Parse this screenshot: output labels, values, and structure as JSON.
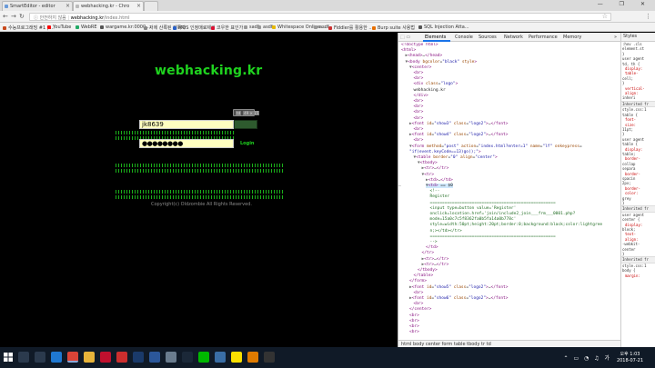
{
  "tabs": [
    {
      "label": "SmartEditor - editor",
      "active": false
    },
    {
      "label": "webhacking.kr - Chro",
      "active": true
    },
    {
      "label": "",
      "active": false
    }
  ],
  "window_buttons": "— ❐ ✕",
  "address": {
    "secure_label": "ⓘ 안전하지 않음",
    "host": "webhacking.kr",
    "path": "/index.html"
  },
  "bookmarks": [
    {
      "label": "수능프로그래밍 #1 | ...",
      "color": "#c84a1c"
    },
    {
      "label": "YouTube",
      "color": "#ff0000"
    },
    {
      "label": "WebRE",
      "color": "#2a6"
    },
    {
      "label": "wargame.kr:0000 ...",
      "color": "#555"
    },
    {
      "label": "저에 산록된 제목자",
      "color": "#888"
    },
    {
      "label": "MOS 인정매료제기",
      "color": "#2a62c9"
    },
    {
      "label": "코우한 표인가",
      "color": "#d13"
    },
    {
      "label": "sadf",
      "color": "#999"
    },
    {
      "label": "asdf",
      "color": "#999"
    },
    {
      "label": "Whitespace Online ...",
      "color": "#e6b800"
    },
    {
      "label": "asdf",
      "color": "#999"
    },
    {
      "label": "Fiddler를 활용한 ...",
      "color": "#c33"
    },
    {
      "label": "Burp suite 사용법",
      "color": "#e76f00"
    },
    {
      "label": "SQL Injection Atta...",
      "color": "#555"
    }
  ],
  "page": {
    "logo": "webhacking.kr",
    "id_value": "jk8639",
    "password_value": "●●●●●●●●",
    "login_label": "Login",
    "tooltip_tag": "td",
    "tooltip_size": "49 × 15",
    "copyright": "Copyright(c) Oldzombie All Rights Reserved."
  },
  "devtools": {
    "tabs": [
      "Elements",
      "Console",
      "Sources",
      "Network",
      "Performance",
      "Memory",
      "»"
    ],
    "lines": [
      {
        "indent": 0,
        "html": "<span class='tg'>&lt;!doctype html&gt;</span>"
      },
      {
        "indent": 0,
        "html": "<span class='tg'>&lt;html&gt;</span>"
      },
      {
        "indent": 1,
        "html": "<span class='arrow'>▶</span><span class='tg'>&lt;head&gt;</span>…<span class='tg'>&lt;/head&gt;</span>"
      },
      {
        "indent": 1,
        "html": "<span class='arrow'>▼</span><span class='tg'>&lt;body </span><span class='at'>bgcolor</span>=<span class='av'>\"black\"</span><span class='at'> style</span><span class='tg'>&gt;</span>"
      },
      {
        "indent": 2,
        "html": "<span class='arrow'>▼</span><span class='tg'>&lt;center&gt;</span>"
      },
      {
        "indent": 3,
        "html": "<span class='tg'>&lt;br&gt;</span>"
      },
      {
        "indent": 3,
        "html": "<span class='tg'>&lt;br&gt;</span>"
      },
      {
        "indent": 3,
        "html": "<span class='tg'>&lt;div </span><span class='at'>class</span>=<span class='av'>\"logo\"</span><span class='tg'>&gt;</span>"
      },
      {
        "indent": 3,
        "html": "<span class='tx'>webhacking.kr</span>"
      },
      {
        "indent": 3,
        "html": "<span class='tg'>&lt;/div&gt;</span>"
      },
      {
        "indent": 3,
        "html": "<span class='tg'>&lt;br&gt;</span>"
      },
      {
        "indent": 3,
        "html": "<span class='tg'>&lt;br&gt;</span>"
      },
      {
        "indent": 3,
        "html": "<span class='tg'>&lt;br&gt;</span>"
      },
      {
        "indent": 3,
        "html": "<span class='tg'>&lt;br&gt;</span>"
      },
      {
        "indent": 2,
        "html": "<span class='arrow'>▶</span><span class='tg'>&lt;font </span><span class='at'>id</span>=<span class='av'>\"show3\"</span><span class='at'> class</span>=<span class='av'>\"logo2\"</span><span class='tg'>&gt;</span>…<span class='tg'>&lt;/font&gt;</span>"
      },
      {
        "indent": 3,
        "html": "<span class='tg'>&lt;br&gt;</span>"
      },
      {
        "indent": 2,
        "html": "<span class='arrow'>▶</span><span class='tg'>&lt;font </span><span class='at'>id</span>=<span class='av'>\"show4\"</span><span class='at'> class</span>=<span class='av'>\"logo2\"</span><span class='tg'>&gt;</span>…<span class='tg'>&lt;/font&gt;</span>"
      },
      {
        "indent": 3,
        "html": "<span class='tg'>&lt;br&gt;</span>"
      },
      {
        "indent": 2,
        "html": "<span class='arrow'>▼</span><span class='tg'>&lt;form </span><span class='at'>method</span>=<span class='av'>\"post\"</span><span class='at'> action</span>=<span class='av'>\"index.html?enter=1\"</span><span class='at'> name</span>=<span class='av'>\"lf\"</span><span class='at'> onkeypress</span>="
      },
      {
        "indent": 2,
        "html": "<span class='av'>\"if(event.keyCode==13)go();\"</span><span class='tg'>&gt;</span>"
      },
      {
        "indent": 3,
        "html": "<span class='arrow'>▼</span><span class='tg'>&lt;table </span><span class='at'>border</span>=<span class='av'>\"0\"</span><span class='at'> align</span>=<span class='av'>\"center\"</span><span class='tg'>&gt;</span>"
      },
      {
        "indent": 4,
        "html": "<span class='arrow'>▼</span><span class='tg'>&lt;tbody&gt;</span>"
      },
      {
        "indent": 5,
        "html": "<span class='arrow'>▶</span><span class='tg'>&lt;tr&gt;</span>…<span class='tg'>&lt;/tr&gt;</span>"
      },
      {
        "indent": 5,
        "html": "<span class='arrow'>▼</span><span class='tg'>&lt;tr&gt;</span>"
      },
      {
        "indent": 6,
        "html": "<span class='arrow'>▶</span><span class='tg'>&lt;td&gt;</span>…<span class='tg'>&lt;/td&gt;</span>"
      },
      {
        "indent": 6,
        "html": "<span class='hl'><span class='arrow'>▼</span><span class='tg'>&lt;td&gt;</span> == $0</span>",
        "selected": true
      },
      {
        "indent": 7,
        "html": "<span class='cm'>&lt;!--</span>"
      },
      {
        "indent": 7,
        "html": "<span class='cm'>Register</span>"
      },
      {
        "indent": 7,
        "html": "<span class='cm'>===================================================</span>"
      },
      {
        "indent": 7,
        "html": "<span class='cm'>&lt;input type=button value='Register'</span>"
      },
      {
        "indent": 7,
        "html": "<span class='cm'>onclick=location.href='join/include2_join___frm___0001.php?</span>"
      },
      {
        "indent": 7,
        "html": "<span class='cm'>mode=15a0c7c5f8362fa0b5fa14a0b778c'</span>"
      },
      {
        "indent": 7,
        "html": "<span class='cm'>style=width:50pt;height:20pt;border:0;background:black;color:lightgree</span>"
      },
      {
        "indent": 7,
        "html": "<span class='cm'>n;&gt;&lt;/td&gt;&lt;/tr&gt;</span>"
      },
      {
        "indent": 7,
        "html": "<span class='cm'>===================================================</span>"
      },
      {
        "indent": 7,
        "html": "<span class='cm'>--&gt;</span>"
      },
      {
        "indent": 6,
        "html": "<span class='tg'>&lt;/td&gt;</span>"
      },
      {
        "indent": 5,
        "html": "<span class='tg'>&lt;/tr&gt;</span>"
      },
      {
        "indent": 5,
        "html": "<span class='arrow'>▶</span><span class='tg'>&lt;tr&gt;</span>…<span class='tg'>&lt;/tr&gt;</span>"
      },
      {
        "indent": 5,
        "html": "<span class='arrow'>▶</span><span class='tg'>&lt;tr&gt;</span>…<span class='tg'>&lt;/tr&gt;</span>"
      },
      {
        "indent": 4,
        "html": "<span class='tg'>&lt;/tbody&gt;</span>"
      },
      {
        "indent": 3,
        "html": "<span class='tg'>&lt;/table&gt;</span>"
      },
      {
        "indent": 2,
        "html": "<span class='tg'>&lt;/form&gt;</span>"
      },
      {
        "indent": 2,
        "html": "<span class='arrow'>▶</span><span class='tg'>&lt;font </span><span class='at'>id</span>=<span class='av'>\"show5\"</span><span class='at'> class</span>=<span class='av'>\"logo2\"</span><span class='tg'>&gt;</span>…<span class='tg'>&lt;/font&gt;</span>"
      },
      {
        "indent": 3,
        "html": "<span class='tg'>&lt;br&gt;</span>"
      },
      {
        "indent": 2,
        "html": "<span class='arrow'>▶</span><span class='tg'>&lt;font </span><span class='at'>id</span>=<span class='av'>\"show6\"</span><span class='at'> class</span>=<span class='av'>\"logo2\"</span><span class='tg'>&gt;</span>…<span class='tg'>&lt;/font&gt;</span>"
      },
      {
        "indent": 3,
        "html": "<span class='tg'>&lt;br&gt;</span>"
      },
      {
        "indent": 2,
        "html": "<span class='tg'>&lt;/center&gt;</span>"
      },
      {
        "indent": 2,
        "html": "<span class='tg'>&lt;br&gt;</span>"
      },
      {
        "indent": 2,
        "html": "<span class='tg'>&lt;br&gt;</span>"
      },
      {
        "indent": 2,
        "html": "<span class='tg'>&lt;br&gt;</span>"
      },
      {
        "indent": 2,
        "html": "<span class='tg'>&lt;br&gt;</span>"
      }
    ],
    "breadcrumb": "html  body  center  form  table  tbody  tr  td",
    "styles_tab": "Styles",
    "styles_lines": [
      {
        "text": ":hov .cls",
        "kind": ""
      },
      {
        "text": "element.st",
        "kind": ""
      },
      {
        "text": "}",
        "kind": ""
      },
      {
        "text": "user agent",
        "kind": ""
      },
      {
        "text": "td, th {",
        "kind": ""
      },
      {
        "text": "display:",
        "kind": "prop"
      },
      {
        "text": "table-",
        "kind": "prop"
      },
      {
        "text": "cell;",
        "kind": ""
      },
      {
        "text": "}",
        "kind": ""
      },
      {
        "text": "vertical-",
        "kind": "prop"
      },
      {
        "text": "align:",
        "kind": "prop"
      },
      {
        "text": "inheri",
        "kind": ""
      },
      {
        "text": "Inherited fr",
        "kind": "sec"
      },
      {
        "text": "style.css:1",
        "kind": ""
      },
      {
        "text": "table {",
        "kind": ""
      },
      {
        "text": "font-",
        "kind": "prop"
      },
      {
        "text": "size:",
        "kind": "prop"
      },
      {
        "text": "11pt;",
        "kind": ""
      },
      {
        "text": "}",
        "kind": ""
      },
      {
        "text": "user agent",
        "kind": ""
      },
      {
        "text": "table {",
        "kind": ""
      },
      {
        "text": "display:",
        "kind": "prop"
      },
      {
        "text": "table;",
        "kind": ""
      },
      {
        "text": "border-",
        "kind": "prop"
      },
      {
        "text": "collap",
        "kind": ""
      },
      {
        "text": "separa",
        "kind": ""
      },
      {
        "text": "border-",
        "kind": "prop"
      },
      {
        "text": "spacin",
        "kind": ""
      },
      {
        "text": "2px;",
        "kind": ""
      },
      {
        "text": "border-",
        "kind": "prop"
      },
      {
        "text": "color:",
        "kind": "prop"
      },
      {
        "text": "grey",
        "kind": ""
      },
      {
        "text": "}",
        "kind": ""
      },
      {
        "text": "Inherited fr",
        "kind": "sec"
      },
      {
        "text": "user agent",
        "kind": ""
      },
      {
        "text": "center {",
        "kind": ""
      },
      {
        "text": "display:",
        "kind": "prop"
      },
      {
        "text": "block;",
        "kind": ""
      },
      {
        "text": "text-",
        "kind": "prop"
      },
      {
        "text": "align:",
        "kind": "prop"
      },
      {
        "text": "-webkit-",
        "kind": ""
      },
      {
        "text": "center",
        "kind": ""
      },
      {
        "text": "}",
        "kind": ""
      },
      {
        "text": "Inherited fr",
        "kind": "sec"
      },
      {
        "text": "style.css:1",
        "kind": ""
      },
      {
        "text": "body {",
        "kind": ""
      },
      {
        "text": "margin:",
        "kind": "prop"
      }
    ]
  },
  "taskbar": {
    "apps": [
      {
        "name": "search-icon",
        "color": "#2b3a4d"
      },
      {
        "name": "task-view-icon",
        "color": "#2b3a4d"
      },
      {
        "name": "edge-icon",
        "color": "#1f78d1"
      },
      {
        "name": "chrome-icon",
        "color": "#db4437"
      },
      {
        "name": "explorer-icon",
        "color": "#e8b43a"
      },
      {
        "name": "mcafee-icon",
        "color": "#c0102e"
      },
      {
        "name": "app-icon",
        "color": "#cc2e2e"
      },
      {
        "name": "photoshop-icon",
        "color": "#1a3a6a"
      },
      {
        "name": "word-icon",
        "color": "#2b579a"
      },
      {
        "name": "vm-icon",
        "color": "#6a7c8e"
      },
      {
        "name": "steam-icon",
        "color": "#1b2838"
      },
      {
        "name": "line-icon",
        "color": "#00b900"
      },
      {
        "name": "store-icon",
        "color": "#3a6ea5"
      },
      {
        "name": "kakao-icon",
        "color": "#f9e000"
      },
      {
        "name": "app2-icon",
        "color": "#e07b00"
      },
      {
        "name": "terminal-icon",
        "color": "#333"
      }
    ],
    "time": "오후 1:03",
    "date": "2018-07-21"
  }
}
